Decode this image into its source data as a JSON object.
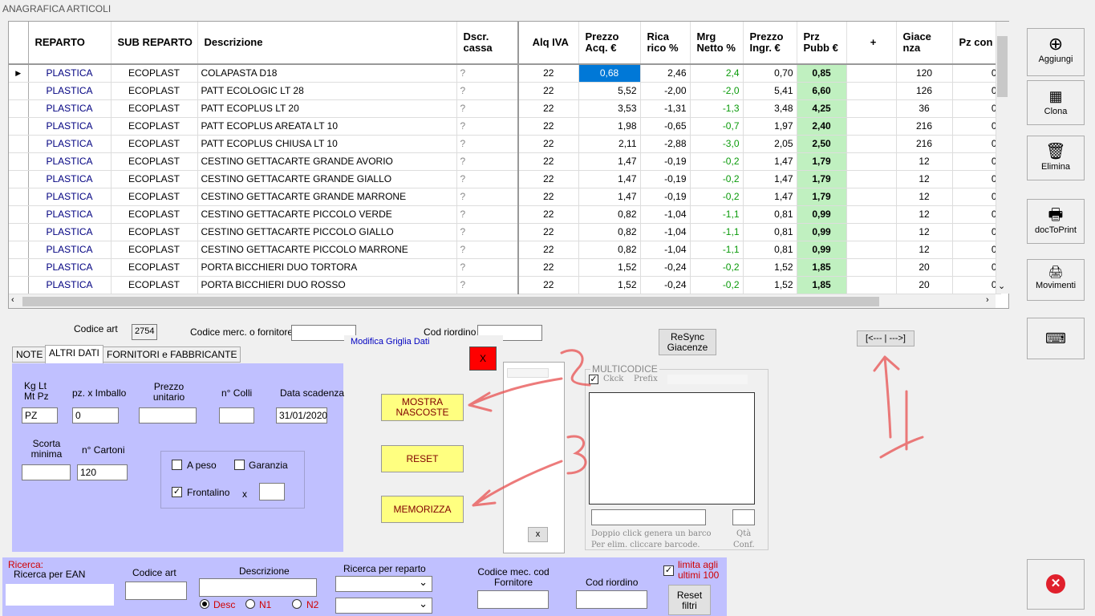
{
  "window_title": "ANAGRAFICA ARTICOLI",
  "grid": {
    "headers": [
      "REPARTO",
      "SUB REPARTO",
      "Descrizione",
      "Dscr. cassa",
      "Alq IVA",
      "Prezzo Acq. €",
      "Rica rico %",
      "Mrg Netto %",
      "Prezzo Ingr. €",
      "Prz Pubb €",
      "+",
      "Giace nza",
      "Pz con"
    ],
    "rows": [
      {
        "rep": "PLASTICA",
        "sub": "ECOPLAST",
        "desc": "COLAPASTA D18",
        "cassa": "?",
        "iva": "22",
        "acq": "0,68",
        "ric": "2,46",
        "mrg": "2,4",
        "ingr": "0,70",
        "pubb": "0,85",
        "giac": "120",
        "pz": "0"
      },
      {
        "rep": "PLASTICA",
        "sub": "ECOPLAST",
        "desc": "PATT ECOLOGIC LT 28",
        "cassa": "?",
        "iva": "22",
        "acq": "5,52",
        "ric": "-2,00",
        "mrg": "-2,0",
        "ingr": "5,41",
        "pubb": "6,60",
        "giac": "126",
        "pz": "0"
      },
      {
        "rep": "PLASTICA",
        "sub": "ECOPLAST",
        "desc": "PATT ECOPLUS LT 20",
        "cassa": "?",
        "iva": "22",
        "acq": "3,53",
        "ric": "-1,31",
        "mrg": "-1,3",
        "ingr": "3,48",
        "pubb": "4,25",
        "giac": "36",
        "pz": "0"
      },
      {
        "rep": "PLASTICA",
        "sub": "ECOPLAST",
        "desc": "PATT ECOPLUS AREATA LT 10",
        "cassa": "?",
        "iva": "22",
        "acq": "1,98",
        "ric": "-0,65",
        "mrg": "-0,7",
        "ingr": "1,97",
        "pubb": "2,40",
        "giac": "216",
        "pz": "0"
      },
      {
        "rep": "PLASTICA",
        "sub": "ECOPLAST",
        "desc": "PATT ECOPLUS CHIUSA LT 10",
        "cassa": "?",
        "iva": "22",
        "acq": "2,11",
        "ric": "-2,88",
        "mrg": "-3,0",
        "ingr": "2,05",
        "pubb": "2,50",
        "giac": "216",
        "pz": "0"
      },
      {
        "rep": "PLASTICA",
        "sub": "ECOPLAST",
        "desc": "CESTINO GETTACARTE GRANDE AVORIO",
        "cassa": "?",
        "iva": "22",
        "acq": "1,47",
        "ric": "-0,19",
        "mrg": "-0,2",
        "ingr": "1,47",
        "pubb": "1,79",
        "giac": "12",
        "pz": "0"
      },
      {
        "rep": "PLASTICA",
        "sub": "ECOPLAST",
        "desc": "CESTINO GETTACARTE GRANDE GIALLO",
        "cassa": "?",
        "iva": "22",
        "acq": "1,47",
        "ric": "-0,19",
        "mrg": "-0,2",
        "ingr": "1,47",
        "pubb": "1,79",
        "giac": "12",
        "pz": "0"
      },
      {
        "rep": "PLASTICA",
        "sub": "ECOPLAST",
        "desc": "CESTINO GETTACARTE GRANDE MARRONE",
        "cassa": "?",
        "iva": "22",
        "acq": "1,47",
        "ric": "-0,19",
        "mrg": "-0,2",
        "ingr": "1,47",
        "pubb": "1,79",
        "giac": "12",
        "pz": "0"
      },
      {
        "rep": "PLASTICA",
        "sub": "ECOPLAST",
        "desc": "CESTINO GETTACARTE PICCOLO VERDE",
        "cassa": "?",
        "iva": "22",
        "acq": "0,82",
        "ric": "-1,04",
        "mrg": "-1,1",
        "ingr": "0,81",
        "pubb": "0,99",
        "giac": "12",
        "pz": "0"
      },
      {
        "rep": "PLASTICA",
        "sub": "ECOPLAST",
        "desc": "CESTINO GETTACARTE PICCOLO GIALLO",
        "cassa": "?",
        "iva": "22",
        "acq": "0,82",
        "ric": "-1,04",
        "mrg": "-1,1",
        "ingr": "0,81",
        "pubb": "0,99",
        "giac": "12",
        "pz": "0"
      },
      {
        "rep": "PLASTICA",
        "sub": "ECOPLAST",
        "desc": "CESTINO GETTACARTE PICCOLO MARRONE",
        "cassa": "?",
        "iva": "22",
        "acq": "0,82",
        "ric": "-1,04",
        "mrg": "-1,1",
        "ingr": "0,81",
        "pubb": "0,99",
        "giac": "12",
        "pz": "0"
      },
      {
        "rep": "PLASTICA",
        "sub": "ECOPLAST",
        "desc": "PORTA BICCHIERI DUO TORTORA",
        "cassa": "?",
        "iva": "22",
        "acq": "1,52",
        "ric": "-0,24",
        "mrg": "-0,2",
        "ingr": "1,52",
        "pubb": "1,85",
        "giac": "20",
        "pz": "0"
      },
      {
        "rep": "PLASTICA",
        "sub": "ECOPLAST",
        "desc": "PORTA BICCHIERI DUO ROSSO",
        "cassa": "?",
        "iva": "22",
        "acq": "1,52",
        "ric": "-0,24",
        "mrg": "-0,2",
        "ingr": "1,52",
        "pubb": "1,85",
        "giac": "20",
        "pz": "0"
      }
    ]
  },
  "side_buttons": {
    "aggiungi": "Aggiungi",
    "clona": "Clona",
    "elimina": "Elimina",
    "doc": "docToPrint",
    "movimenti": "Movimenti"
  },
  "form": {
    "codice_art_label": "Codice art",
    "codice_art_value": "2754",
    "codice_merc_label": "Codice merc. o fornitore:",
    "cod_riordino_label": "Cod riordino",
    "resync_label": "ReSync Giacenze",
    "nav_label": "[<--- | --->]",
    "tabs": [
      "NOTE",
      "ALTRI DATI",
      "FORNITORI e FABBRICANTE"
    ],
    "kg_label": "Kg Lt Mt Pz",
    "kg_value": "PZ",
    "imballo_label": "pz. x Imballo",
    "imballo_value": "0",
    "prezzo_label": "Prezzo unitario",
    "colli_label": "n° Colli",
    "scadenza_label": "Data scadenza",
    "scadenza_value": "31/01/2020",
    "scorta_label": "Scorta minima",
    "cartoni_label": "n° Cartoni",
    "cartoni_value": "120",
    "a_peso_label": "A peso",
    "garanzia_label": "Garanzia",
    "frontalino_label": "Frontalino",
    "x_label": "x"
  },
  "modifica": {
    "title": "Modifica Griglia Dati",
    "close": "X",
    "mostra": "MOSTRA NASCOSTE",
    "reset": "RESET",
    "memorizza": "MEMORIZZA",
    "small_x": "x"
  },
  "multicodice": {
    "title": "MULTICODICE",
    "ckck": "Ckck",
    "prefix": "Prefix",
    "hint1": "Doppio click genera un barco",
    "hint2": "Per elim. cliccare barcode.",
    "qta": "Qtà",
    "conf": "Conf."
  },
  "search": {
    "title": "Ricerca:",
    "ean": "Ricerca per EAN",
    "codice_art": "Codice art",
    "descrizione": "Descrizione",
    "reparto": "Ricerca per reparto",
    "codice_mec": "Codice mec. cod Fornitore",
    "cod_riordino": "Cod riordino",
    "limita": "limita agli ultimi 100",
    "reset": "Reset filtri",
    "radio_desc": "Desc",
    "radio_n1": "N1",
    "radio_n2": "N2"
  },
  "annotations": {
    "n1": "1",
    "n2": "2",
    "n3": "3"
  },
  "colors": {
    "panel": "#c0c0ff",
    "yellow_btn": "#ffff80",
    "price_cell": "#c0f0c0",
    "selected": "#0078d7",
    "close_red": "#ff0000"
  }
}
